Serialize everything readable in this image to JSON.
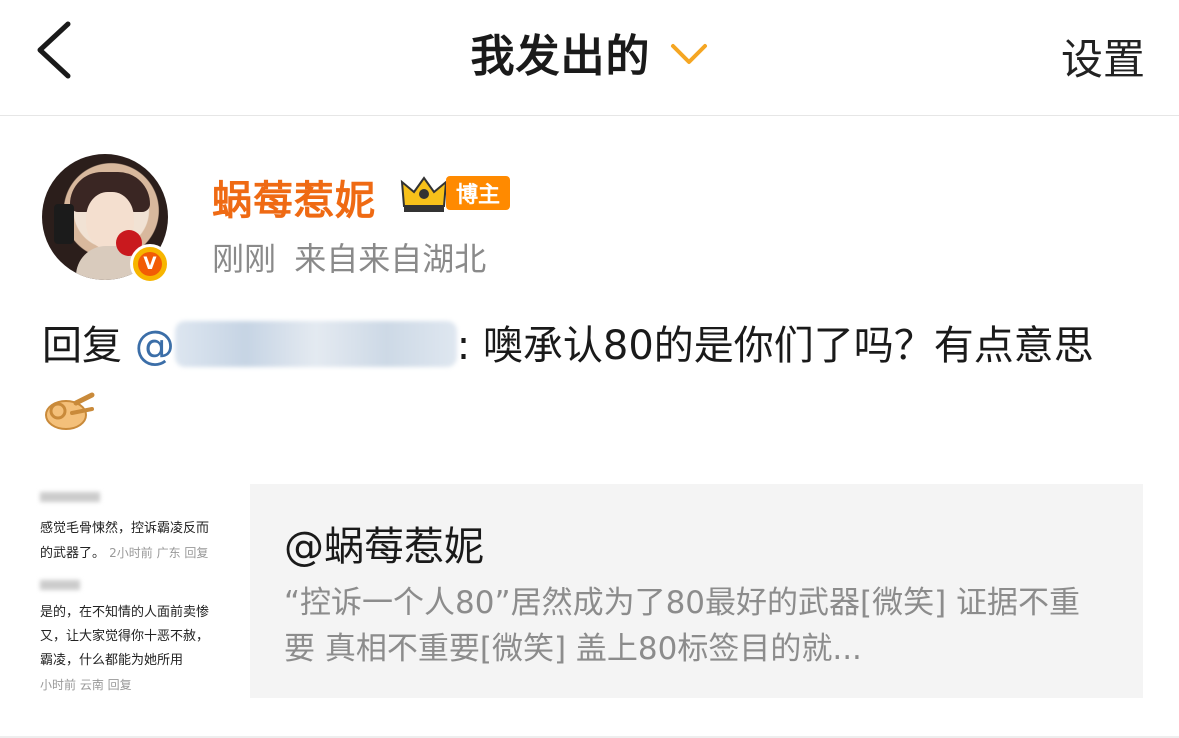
{
  "header": {
    "title": "我发出的",
    "settings_label": "设置"
  },
  "post": {
    "username": "蜗莓惹妮",
    "badge_label": "博主",
    "time": "刚刚",
    "source": "来自来自湖北",
    "reply_prefix": "回复",
    "mention_at": "@",
    "text_after_mention": ": 噢承认80的是你们了吗？有点意思"
  },
  "quoted": {
    "title": "@蜗莓惹妮",
    "description": "“控诉一个人80”居然成为了80最好的武器[微笑] 证据不重要 真相不重要[微笑] 盖上80标签目的就...",
    "thumbnail_lines": [
      "感觉毛骨悚然，控诉霸凌反而",
      "的武器了。",
      "2小时前 广东  回复",
      "是的，在不知情的人面前卖惨",
      "又，让大家觉得你十恶不赦，",
      "霸凌，什么都能为她所用",
      "小时前 云南  回复"
    ]
  },
  "colors": {
    "accent_orange": "#ef6a13",
    "mention_blue": "#3b6ea8",
    "chevron_orange": "#f5a623"
  },
  "icons": {
    "back": "chevron-left-icon",
    "title_dropdown": "chevron-down-icon",
    "verified": "verified-v-icon",
    "crown": "crown-icon",
    "emoji": "ok-hand-emoji-icon"
  }
}
